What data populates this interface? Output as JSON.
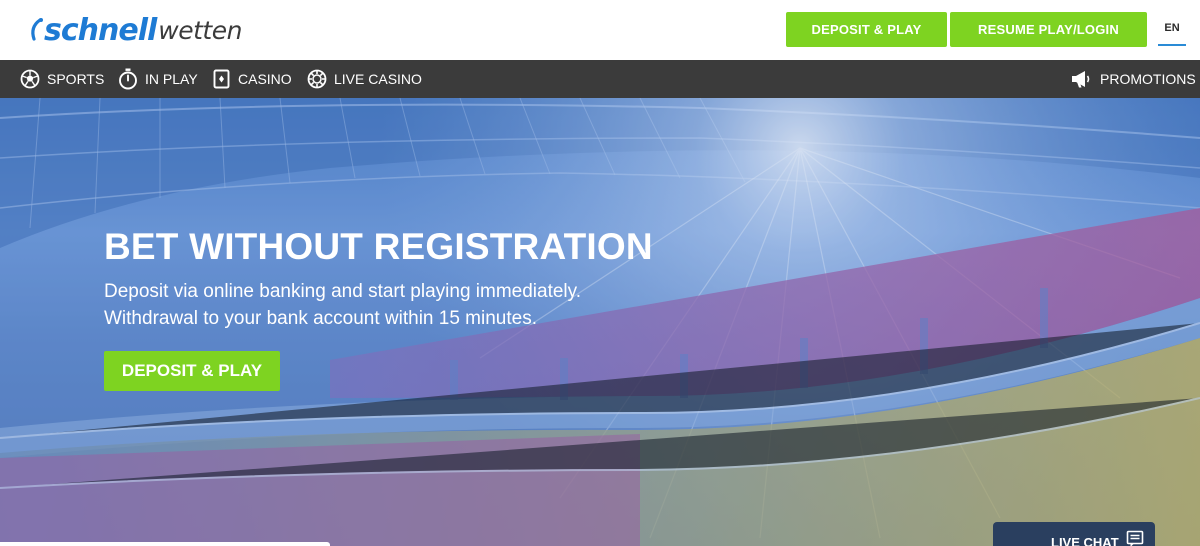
{
  "header": {
    "logo_bold": "schnell",
    "logo_light": "wetten",
    "deposit_label": "DEPOSIT & PLAY",
    "resume_label": "RESUME PLAY/LOGIN",
    "language": "EN"
  },
  "nav": {
    "items": [
      {
        "label": "SPORTS",
        "icon": "soccer-ball-icon"
      },
      {
        "label": "IN PLAY",
        "icon": "stopwatch-icon"
      },
      {
        "label": "CASINO",
        "icon": "playing-card-icon"
      },
      {
        "label": "LIVE CASINO",
        "icon": "poker-chip-icon"
      }
    ],
    "promotions": {
      "label": "PROMOTIONS",
      "icon": "megaphone-icon"
    }
  },
  "hero": {
    "title": "BET WITHOUT REGISTRATION",
    "subtitle_line1": "Deposit via online banking and start playing immediately.",
    "subtitle_line2": "Withdrawal to your bank account within 15 minutes.",
    "cta_label": "DEPOSIT & PLAY"
  },
  "live_chat": {
    "label": "LIVE CHAT",
    "icon": "chat-icon"
  },
  "colors": {
    "accent_green": "#7ed321",
    "brand_blue": "#1e7bd4",
    "nav_bg": "#3b3b3b",
    "chat_bg": "#2a3f5f"
  }
}
